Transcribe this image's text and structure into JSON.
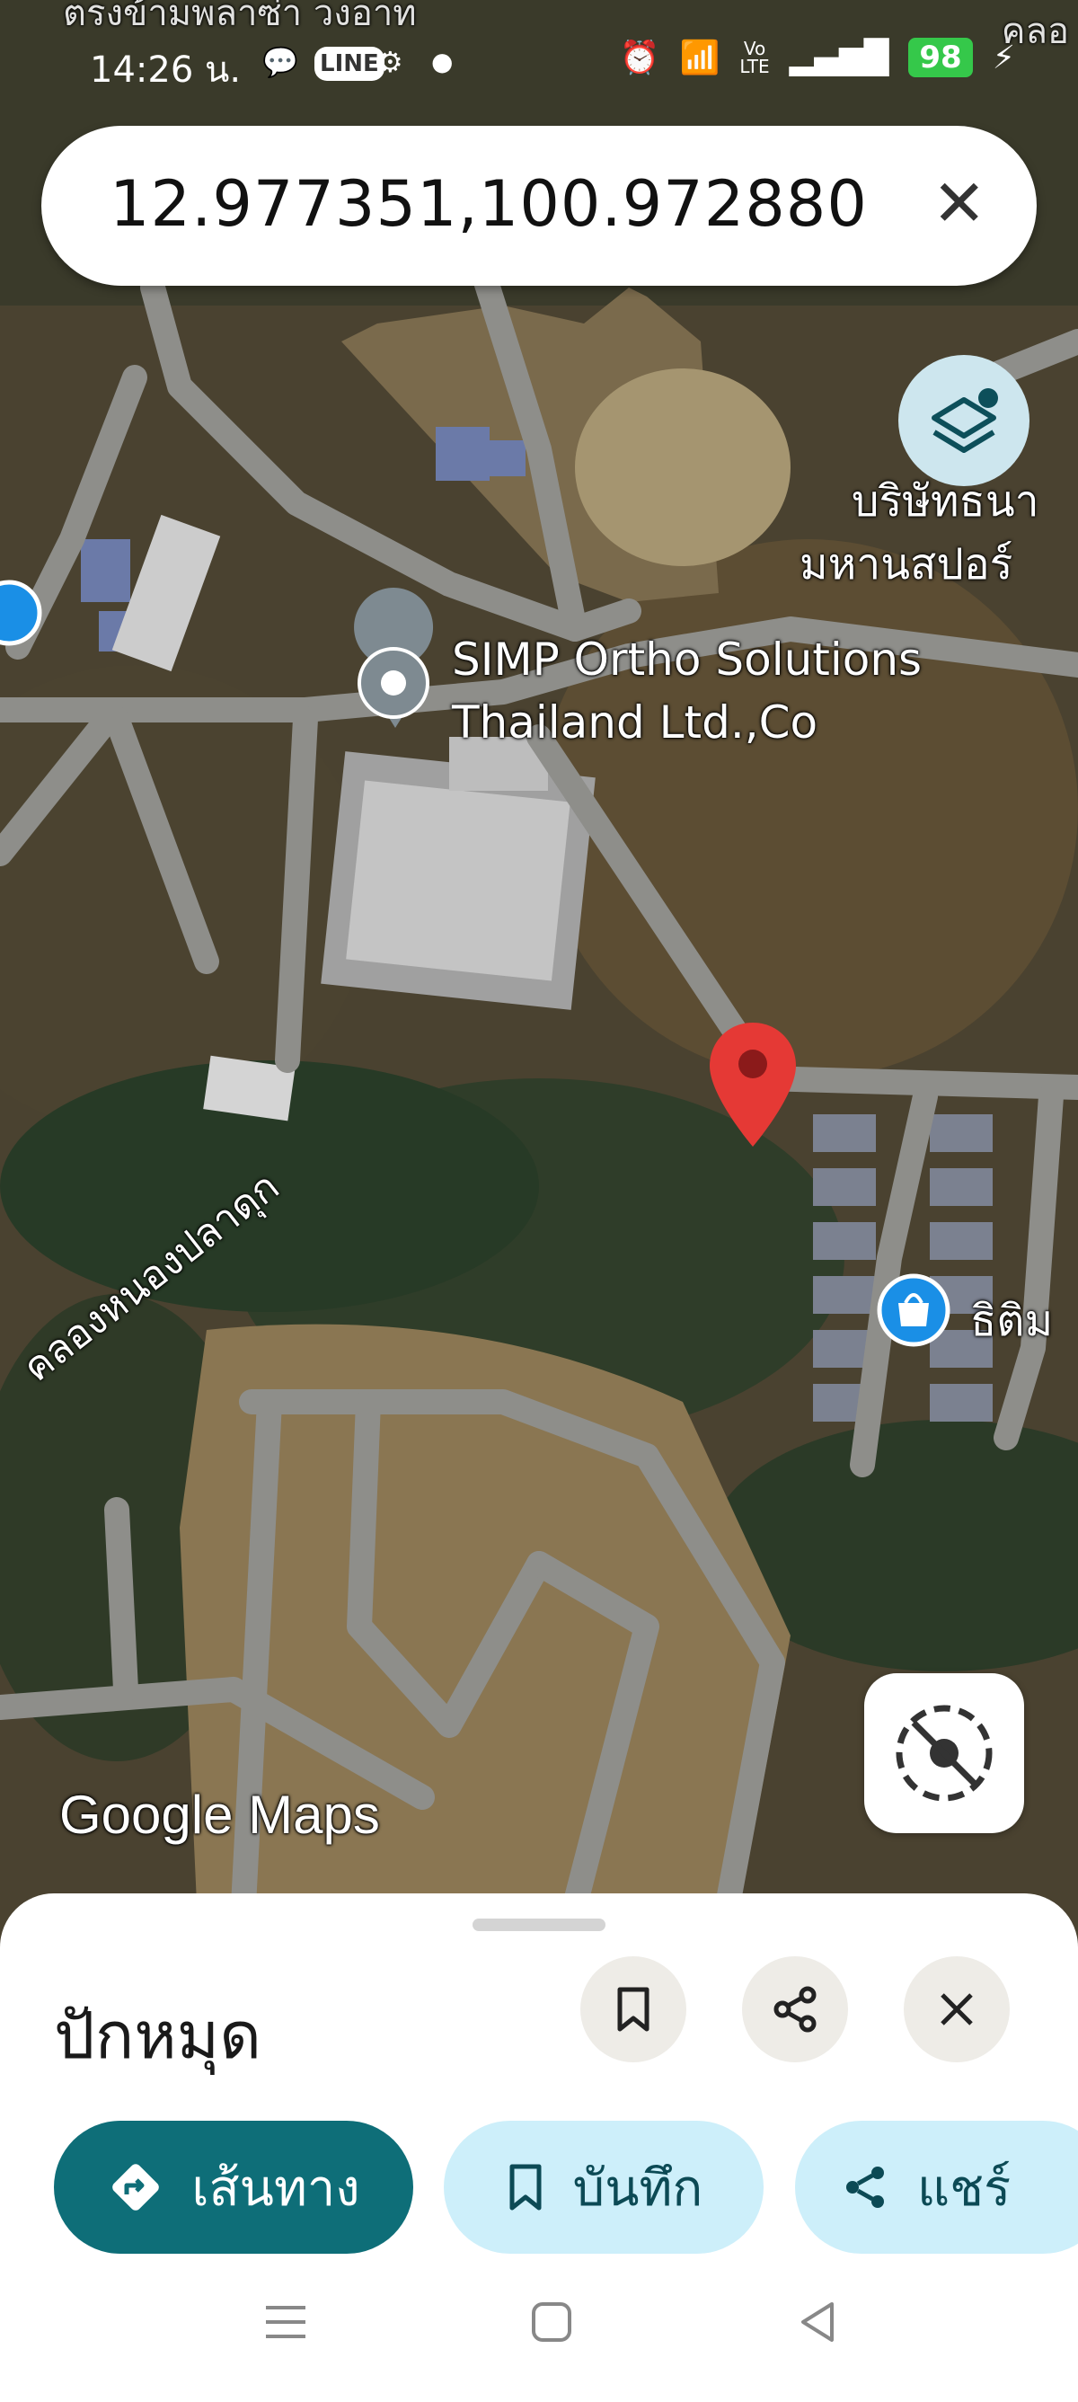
{
  "status_bar": {
    "time": "14:26 น.",
    "battery": "98",
    "clipped_left": "ตรงข้ามพลาซ่า วงอาท",
    "clipped_right": "คลอ"
  },
  "search": {
    "query": "12.977351,100.972880"
  },
  "map": {
    "labels": {
      "company_line1": "บริษัทธนา",
      "company_line2": "มหานสปอร์",
      "simp_line1": "SIMP Ortho Solutions",
      "simp_line2": "Thailand Ltd.,Co",
      "canal": "คลองหนองปลาดุก",
      "shop": "ธิติม"
    },
    "watermark": "Google Maps",
    "colors": {
      "pin": "#e53935",
      "shop_marker": "#1a8fe6",
      "cart_marker": "#1a8fe6"
    }
  },
  "sheet": {
    "title": "ปักหมุด",
    "actions": {
      "route": "เส้นทาง",
      "save": "บันทึก",
      "share": "แชร์"
    },
    "colors": {
      "route_bg": "#0e6e78",
      "pill_bg": "#cdeffa"
    }
  }
}
